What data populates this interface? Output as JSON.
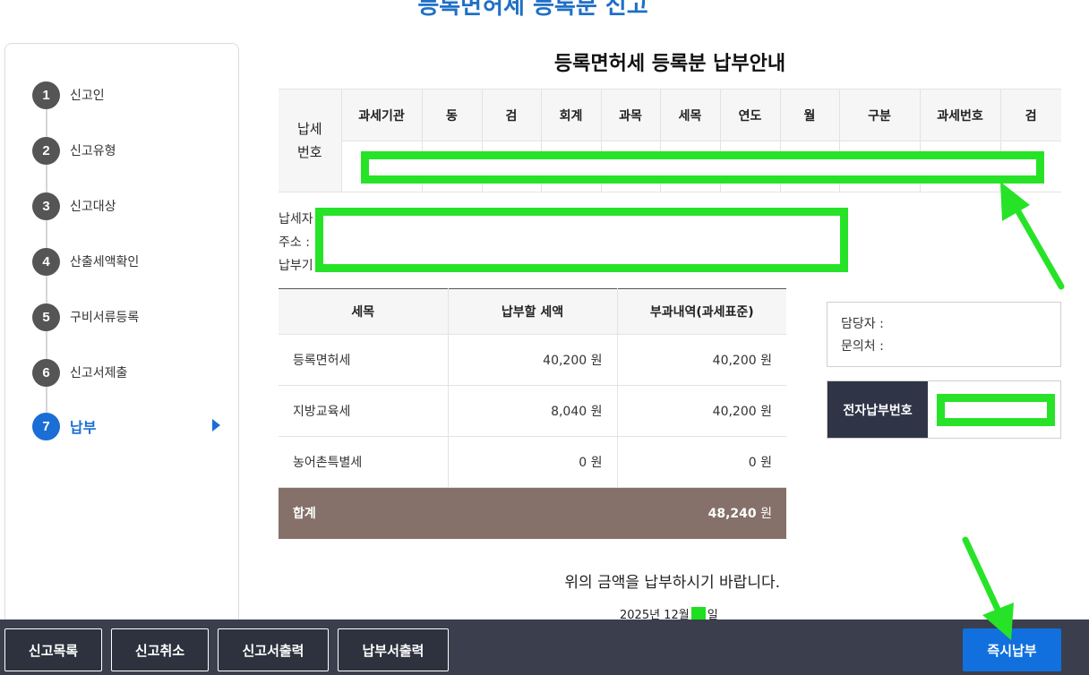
{
  "page": {
    "title": "등록면허세 등록분 신고"
  },
  "steps": [
    {
      "num": "1",
      "label": "신고인",
      "active": false
    },
    {
      "num": "2",
      "label": "신고유형",
      "active": false
    },
    {
      "num": "3",
      "label": "신고대상",
      "active": false
    },
    {
      "num": "4",
      "label": "산출세액확인",
      "active": false
    },
    {
      "num": "5",
      "label": "구비서류등록",
      "active": false
    },
    {
      "num": "6",
      "label": "신고서제출",
      "active": false
    },
    {
      "num": "7",
      "label": "납부",
      "active": true
    }
  ],
  "section": {
    "title": "등록면허세 등록분 납부안내"
  },
  "tax_number": {
    "row_header_line1": "납세",
    "row_header_line2": "번호",
    "columns": [
      "과세기관",
      "동",
      "검",
      "회계",
      "과목",
      "세목",
      "연도",
      "월",
      "구분",
      "과세번호",
      "검"
    ]
  },
  "payer": {
    "name_label": "납세자",
    "address_label": "주소 :",
    "due_label": "납부기"
  },
  "amount_table": {
    "headers": [
      "세목",
      "납부할 세액",
      "부과내역(과세표준)"
    ],
    "rows": [
      {
        "name": "등록면허세",
        "amount": "40,200",
        "basis": "40,200",
        "unit": "원"
      },
      {
        "name": "지방교육세",
        "amount": "8,040",
        "basis": "40,200",
        "unit": "원"
      },
      {
        "name": "농어촌특별세",
        "amount": "0",
        "basis": "0",
        "unit": "원"
      }
    ],
    "total": {
      "name": "합계",
      "amount": "48,240",
      "unit": "원"
    }
  },
  "contact": {
    "manager_label": "담당자 :",
    "phone_label": "문의처 :"
  },
  "epay": {
    "label": "전자납부번호"
  },
  "notice": "위의 금액을 납부하시기 바랍니다.",
  "date": {
    "prefix": "2025년 12월",
    "suffix": "일"
  },
  "buttons": {
    "list": "신고목록",
    "cancel": "신고취소",
    "print_report": "신고서출력",
    "print_payment": "납부서출력",
    "pay_now": "즉시납부"
  },
  "annotation_color": "#27e327"
}
